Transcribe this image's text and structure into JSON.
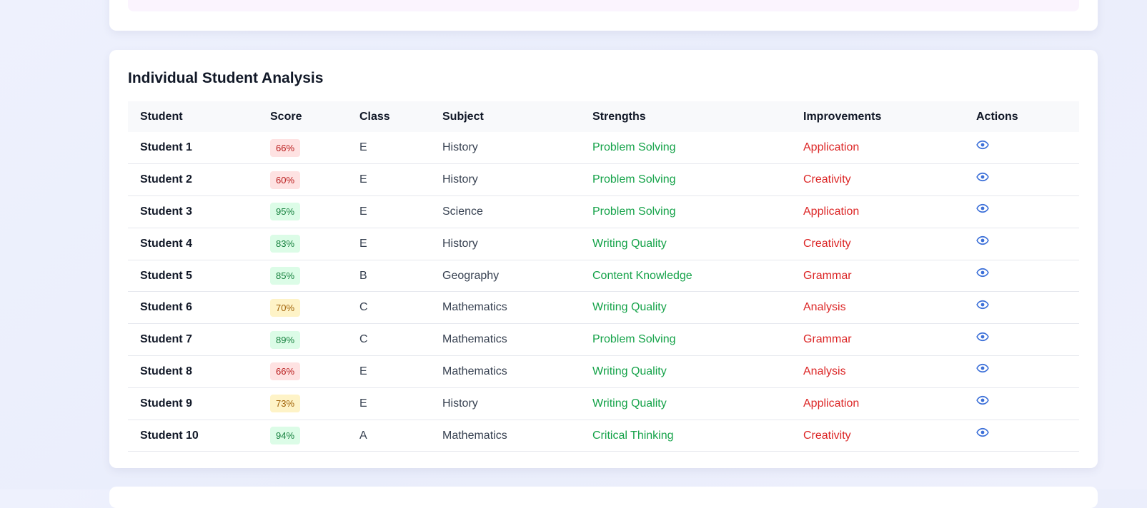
{
  "section": {
    "title": "Individual Student Analysis"
  },
  "table": {
    "headers": [
      "Student",
      "Score",
      "Class",
      "Subject",
      "Strengths",
      "Improvements",
      "Actions"
    ],
    "rows": [
      {
        "student": "Student 1",
        "score": "66%",
        "level": "low",
        "class": "E",
        "subject": "History",
        "strength": "Problem Solving",
        "improvement": "Application"
      },
      {
        "student": "Student 2",
        "score": "60%",
        "level": "low",
        "class": "E",
        "subject": "History",
        "strength": "Problem Solving",
        "improvement": "Creativity"
      },
      {
        "student": "Student 3",
        "score": "95%",
        "level": "high",
        "class": "E",
        "subject": "Science",
        "strength": "Problem Solving",
        "improvement": "Application"
      },
      {
        "student": "Student 4",
        "score": "83%",
        "level": "high",
        "class": "E",
        "subject": "History",
        "strength": "Writing Quality",
        "improvement": "Creativity"
      },
      {
        "student": "Student 5",
        "score": "85%",
        "level": "high",
        "class": "B",
        "subject": "Geography",
        "strength": "Content Knowledge",
        "improvement": "Grammar"
      },
      {
        "student": "Student 6",
        "score": "70%",
        "level": "mid",
        "class": "C",
        "subject": "Mathematics",
        "strength": "Writing Quality",
        "improvement": "Analysis"
      },
      {
        "student": "Student 7",
        "score": "89%",
        "level": "high",
        "class": "C",
        "subject": "Mathematics",
        "strength": "Problem Solving",
        "improvement": "Grammar"
      },
      {
        "student": "Student 8",
        "score": "66%",
        "level": "low",
        "class": "E",
        "subject": "Mathematics",
        "strength": "Writing Quality",
        "improvement": "Analysis"
      },
      {
        "student": "Student 9",
        "score": "73%",
        "level": "mid",
        "class": "E",
        "subject": "History",
        "strength": "Writing Quality",
        "improvement": "Application"
      },
      {
        "student": "Student 10",
        "score": "94%",
        "level": "high",
        "class": "A",
        "subject": "Mathematics",
        "strength": "Critical Thinking",
        "improvement": "Creativity"
      }
    ],
    "action_icon": "eye-icon"
  },
  "colors": {
    "accent": "#3b6fd8",
    "strength": "#16a34a",
    "improvement": "#dc2626"
  }
}
